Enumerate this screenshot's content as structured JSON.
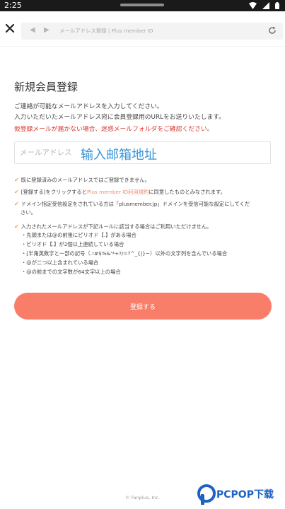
{
  "status_bar": {
    "time": "2:25"
  },
  "browser": {
    "url_text": "メールアドレス登録 | Plus member ID",
    "back_glyph": "◀",
    "forward_glyph": "▶"
  },
  "page": {
    "title": "新規会員登録",
    "intro_lines": [
      "ご連絡が可能なメールアドレスを入力してください。",
      "入力いただいたメールアドレス宛に会員登録用のURLをお送りいたします。"
    ],
    "warning": "仮登録メールが届かない場合、迷惑メールフォルダをご確認ください。",
    "email_placeholder": "メールアドレス",
    "overlay_text": "输入邮箱地址",
    "check_glyph": "✔",
    "notes": [
      "既に登録済みのメールアドレスではご登録できません。",
      "ドメイン指定受信設定をされている方は「plusmember.jp」ドメインを受信可能な設定にしてくだ",
      "さい。",
      "入力されたメールアドレスが下記ルールに該当する場合はご利用いただけません。"
    ],
    "note_terms": {
      "before": "[登録する]をクリックすると",
      "link": "Plus member ID利用規約",
      "after": "に同意したものとみなされます。"
    },
    "rules": [
      "・先頭または@の前後にピリオド【.】がある場合",
      "・ピリオド【.】が2個以上連続している場合",
      "・[半角英数字と一部の記号（.!#$%&'*+?/=?^_{|}~）以外の文字列を含んでいる場合",
      "・@が二つ以上含まれている場合",
      "・@の前までの文字数が64文字以上の場合"
    ],
    "submit_label": "登録する",
    "footer": "© Fanplus, Inc."
  },
  "watermark": {
    "brand": "PCPOP下载"
  },
  "colors": {
    "accent": "#f97e6a",
    "warning": "#d9342b",
    "check": "#f3a43a",
    "link": "#f08c73",
    "watermark_blue": "#3795da"
  }
}
